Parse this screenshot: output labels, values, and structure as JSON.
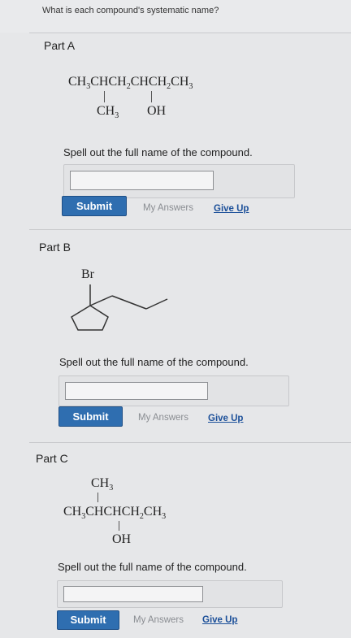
{
  "question": "What is each compound's systematic name?",
  "parts": [
    {
      "title": "Part A",
      "structure": {
        "main_chain": "CH3CHCH2CHCH2CH3",
        "sub1": "CH3",
        "sub2": "OH"
      },
      "prompt": "Spell out the full name of the compound.",
      "submit_label": "Submit",
      "my_answers_label": "My Answers",
      "give_up_label": "Give Up"
    },
    {
      "title": "Part B",
      "structure": {
        "label": "Br"
      },
      "prompt": "Spell out the full name of the compound.",
      "submit_label": "Submit",
      "my_answers_label": "My Answers",
      "give_up_label": "Give Up"
    },
    {
      "title": "Part C",
      "structure": {
        "top": "CH3",
        "main_chain": "CH3CHCHCH2CH3",
        "bottom": "OH"
      },
      "prompt": "Spell out the full name of the compound.",
      "submit_label": "Submit",
      "my_answers_label": "My Answers",
      "give_up_label": "Give Up"
    }
  ]
}
